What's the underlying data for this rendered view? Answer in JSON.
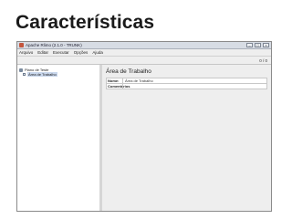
{
  "slide": {
    "title": "Características"
  },
  "window": {
    "title": "Apache Rlimo (2.1.0 - TRUNK)"
  },
  "menu": {
    "items": [
      "Arquivo",
      "Editar",
      "Executar",
      "Opções",
      "Ajuda"
    ]
  },
  "toolbar": {
    "page_counter": "0 / 0"
  },
  "tree": {
    "root_label": "Plano de Teste",
    "child_label": "Área de Trabalho"
  },
  "detail": {
    "title": "Área de Trabalho",
    "fields": [
      {
        "label": "Nome:",
        "value": "Área de Trabalho"
      },
      {
        "label": "Comentários",
        "value": ""
      }
    ]
  }
}
